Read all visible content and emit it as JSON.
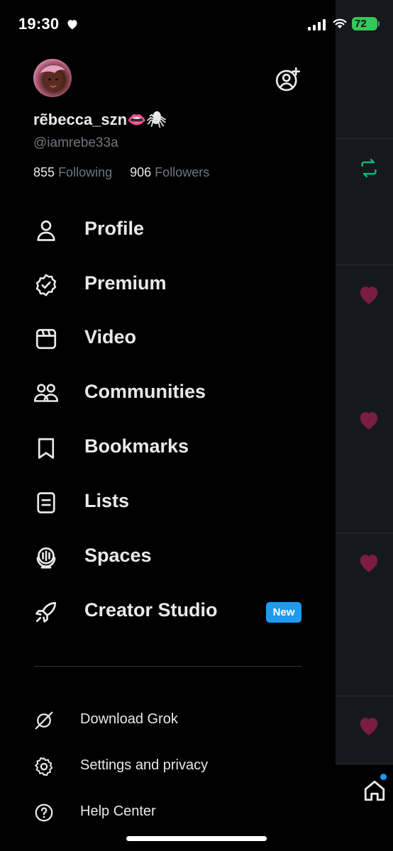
{
  "status_bar": {
    "time": "19:30",
    "battery": "72"
  },
  "account": {
    "display_name": "rẽbecca_szn👄🕷",
    "handle": "@iamrebe33a",
    "following_count": "855",
    "following_label": "Following",
    "followers_count": "906",
    "followers_label": "Followers"
  },
  "menu": [
    {
      "label": "Profile",
      "icon": "person-icon"
    },
    {
      "label": "Premium",
      "icon": "verified-badge-icon"
    },
    {
      "label": "Video",
      "icon": "video-clapper-icon"
    },
    {
      "label": "Communities",
      "icon": "people-icon"
    },
    {
      "label": "Bookmarks",
      "icon": "bookmark-icon"
    },
    {
      "label": "Lists",
      "icon": "list-icon"
    },
    {
      "label": "Spaces",
      "icon": "spaces-mic-icon"
    },
    {
      "label": "Creator Studio",
      "icon": "rocket-icon",
      "badge": "New"
    }
  ],
  "secondary": [
    {
      "label": "Download Grok",
      "icon": "grok-icon"
    },
    {
      "label": "Settings and privacy",
      "icon": "gear-icon"
    },
    {
      "label": "Help Center",
      "icon": "help-circle-icon"
    }
  ],
  "colors": {
    "accent": "#1d9bf0",
    "repost": "#00ba7c",
    "like": "#f91880",
    "text": "#e7e9ea",
    "muted": "#71767b"
  }
}
